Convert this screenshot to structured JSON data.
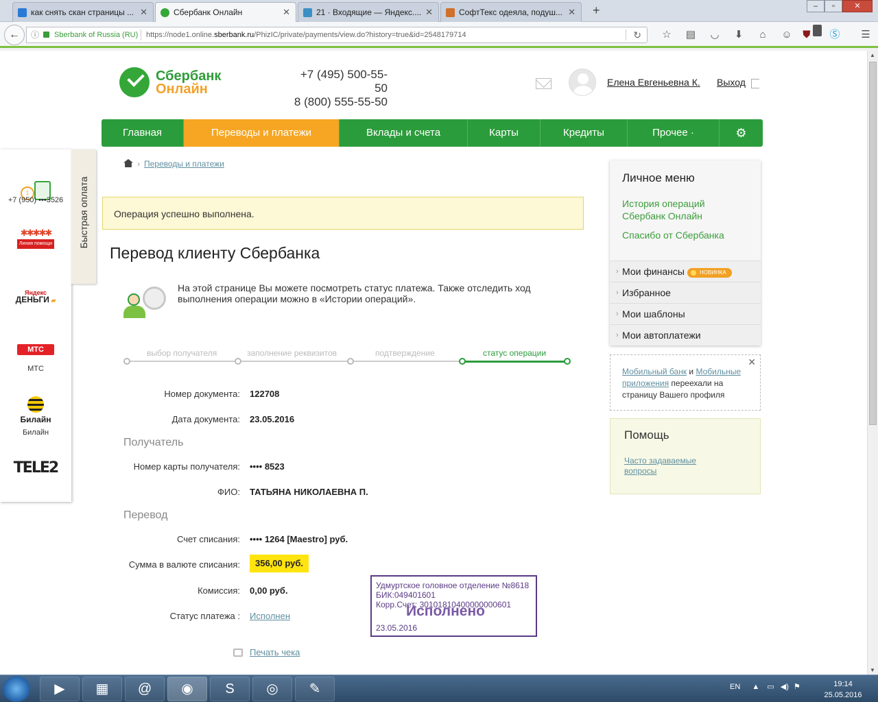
{
  "browser": {
    "tabs": [
      {
        "title": "как снять скан страницы ...",
        "icon": "search-favicon"
      },
      {
        "title": "Сбербанк Онлайн",
        "icon": "sberbank-favicon"
      },
      {
        "title": "21 · Входящие — Яндекс....",
        "icon": "mail-favicon"
      },
      {
        "title": "СофтТекс одеяла, подуш...",
        "icon": "softtex-favicon"
      }
    ],
    "site_identity": "Sberbank of Russia (RU)",
    "url_prefix": "https://node1.online.",
    "url_domain": "sberbank.ru",
    "url_suffix": "/PhizIC/private/payments/view.do?history=true&id=2548179714",
    "extension_badge": "3"
  },
  "header": {
    "logo_line1": "Сбербанк",
    "logo_line2": "Онлайн",
    "phone1": "+7 (495) 500-55-50",
    "phone2": "8 (800) 555-55-50",
    "user_name": "Елена Евгеньевна К.",
    "logout": "Выход"
  },
  "menu": {
    "items": [
      "Главная",
      "Переводы и платежи",
      "Вклады и счета",
      "Карты",
      "Кредиты",
      "Прочее ·"
    ],
    "active_index": 1
  },
  "quickpay": {
    "tab_label": "Быстрая оплата",
    "phone": "+7 (950) •••3526",
    "redbar_text": "Линия помощи",
    "yandex_line1": "Яндекс",
    "yandex_line2": "ДЕНЬГИ",
    "mts_logo": "МТС",
    "mts_label": "МТС",
    "beeline_logo": "Билайн",
    "beeline_label": "Билайн",
    "tele2": "TELE2"
  },
  "breadcrumb": {
    "link": "Переводы и платежи"
  },
  "success_message": "Операция успешно выполнена.",
  "page_title": "Перевод клиенту Сбербанка",
  "info_text": "На этой странице Вы можете посмотреть статус платежа. Также отследить ход выполнения операции можно в «Истории операций».",
  "steps": [
    "выбор получателя",
    "заполнение реквизитов",
    "подтверждение",
    "статус операции"
  ],
  "details": {
    "doc_number_label": "Номер документа:",
    "doc_number": "122708",
    "doc_date_label": "Дата документа:",
    "doc_date": "23.05.2016",
    "recipient_section": "Получатель",
    "card_label": "Номер карты получателя:",
    "card": "•••• 8523",
    "fio_label": "ФИО:",
    "fio": "ТАТЬЯНА НИКОЛАЕВНА П.",
    "transfer_section": "Перевод",
    "account_label": "Счет списания:",
    "account": "•••• 1264  [Maestro]  руб.",
    "amount_label": "Сумма в валюте списания:",
    "amount": "356,00  руб.",
    "fee_label": "Комиссия:",
    "fee": "0,00 руб.",
    "status_label": "Статус платежа :",
    "status": "Исполнен",
    "print": "Печать чека"
  },
  "stamp": {
    "line1": "Удмуртское головное отделение №8618",
    "line2": "БИК:049401601",
    "line3": "Корр.Счет: 30101810400000000601",
    "status": "Исполнено",
    "date": "23.05.2016"
  },
  "personal_menu": {
    "title": "Личное меню",
    "history_link": "История операций Сбербанк Онлайн",
    "thanks_link": "Спасибо от Сбербанка",
    "items": [
      "Мои финансы",
      "Избранное",
      "Мои шаблоны",
      "Мои автоплатежи"
    ],
    "new_badge": "НОВИНКА"
  },
  "mobile_notice": {
    "link1": "Мобильный банк",
    "and": " и ",
    "link2": "Мобильные приложения",
    "text": " переехали на страницу Вашего профиля"
  },
  "help": {
    "title": "Помощь",
    "faq": "Часто задаваемые вопросы"
  },
  "taskbar": {
    "lang": "EN",
    "time": "19:14",
    "date": "25.05.2016"
  }
}
